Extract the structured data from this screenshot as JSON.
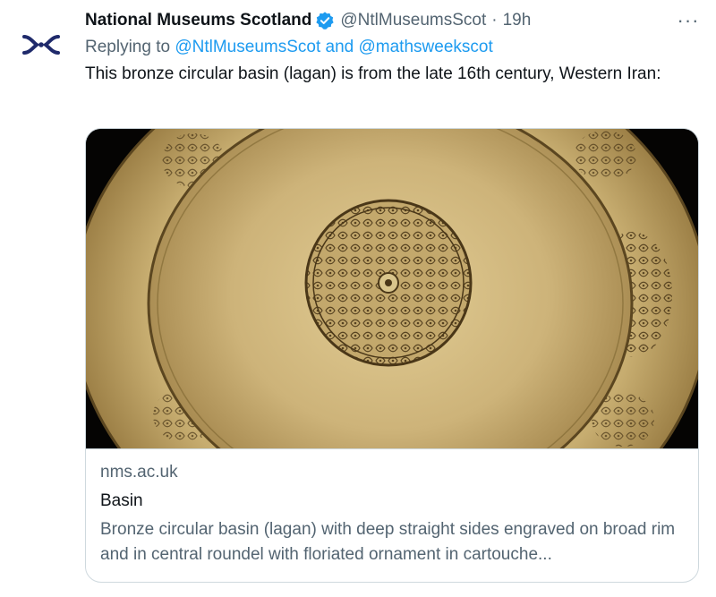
{
  "author": {
    "avatar_icon": "nms-logo-icon",
    "display_name": "National Museums Scotland",
    "verified_icon": "verified-badge-icon",
    "handle": "@NtlMuseumsScot",
    "separator": "·",
    "time": "19h"
  },
  "more_label": "···",
  "reply": {
    "prefix": "Replying to ",
    "mention_1": "@NtlMuseumsScot",
    "conjunction": " and ",
    "mention_2": "@mathsweekscot"
  },
  "tweet_text": "This bronze circular basin (lagan) is from the late 16th century, Western Iran:",
  "link_card": {
    "image_icon": "bronze-basin-image",
    "domain": "nms.ac.uk",
    "title": "Basin",
    "description": "Bronze circular basin (lagan) with deep straight sides engraved on broad rim and in central roundel with floriated ornament in cartouche..."
  },
  "colors": {
    "link": "#1d9bf0",
    "secondary_text": "#536471",
    "logo": "#1f2a6b",
    "basin_gold": "#c9b27a"
  }
}
